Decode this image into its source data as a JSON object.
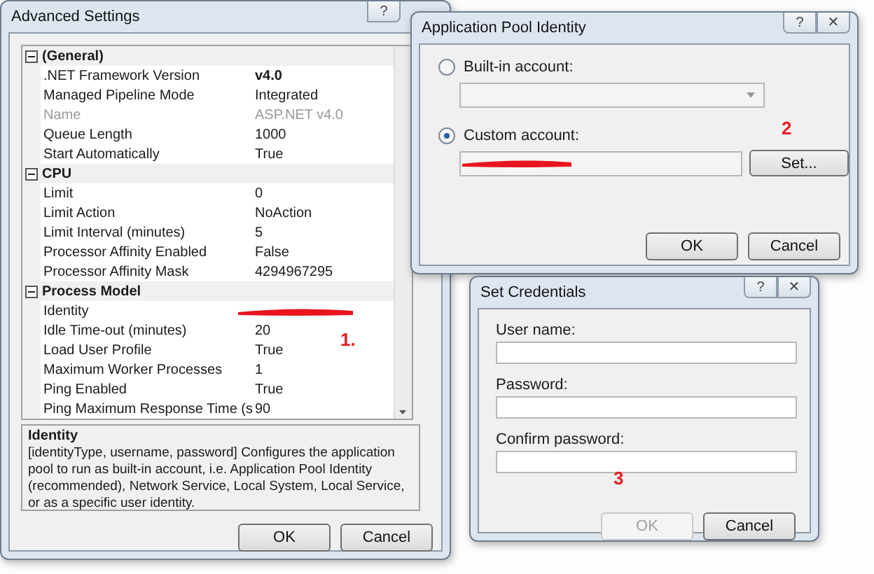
{
  "advanced_settings": {
    "title": "Advanced Settings",
    "help_button": "?",
    "categories": [
      {
        "name": "(General)",
        "expanded": true,
        "properties": [
          {
            "name": ".NET Framework Version",
            "value": "v4.0",
            "bold": true,
            "disabled": false
          },
          {
            "name": "Managed Pipeline Mode",
            "value": "Integrated",
            "bold": false,
            "disabled": false,
            "redacted": false
          },
          {
            "name": "Name",
            "value": "ASP.NET v4.0",
            "bold": false,
            "disabled": true,
            "redacted": false
          },
          {
            "name": "Queue Length",
            "value": "1000",
            "bold": false,
            "disabled": false,
            "redacted": false
          },
          {
            "name": "Start Automatically",
            "value": "True",
            "bold": false,
            "disabled": false,
            "redacted": false
          }
        ]
      },
      {
        "name": "CPU",
        "expanded": true,
        "properties": [
          {
            "name": "Limit",
            "value": "0",
            "bold": false,
            "disabled": false,
            "redacted": false
          },
          {
            "name": "Limit Action",
            "value": "NoAction",
            "bold": false,
            "disabled": false,
            "redacted": false
          },
          {
            "name": "Limit Interval (minutes)",
            "value": "5",
            "bold": false,
            "disabled": false,
            "redacted": false
          },
          {
            "name": "Processor Affinity Enabled",
            "value": "False",
            "bold": false,
            "disabled": false,
            "redacted": false
          },
          {
            "name": "Processor Affinity Mask",
            "value": "4294967295",
            "bold": false,
            "disabled": false,
            "redacted": false
          }
        ]
      },
      {
        "name": "Process Model",
        "expanded": true,
        "properties": [
          {
            "name": "Identity",
            "disabled": false,
            "redacted": true,
            "annotation": "1."
          },
          {
            "name": "Idle Time-out (minutes)",
            "value": "20",
            "bold": false,
            "disabled": false,
            "redacted": false
          },
          {
            "name": "Load User Profile",
            "value": "True",
            "bold": false,
            "disabled": false,
            "redacted": false
          },
          {
            "name": "Maximum Worker Processes",
            "value": "1",
            "bold": false,
            "disabled": false,
            "redacted": false
          },
          {
            "name": "Ping Enabled",
            "value": "True",
            "bold": false,
            "disabled": false,
            "redacted": false
          },
          {
            "name": "Ping Maximum Response Time (s",
            "value": "90",
            "bold": false,
            "disabled": false,
            "redacted": false
          }
        ]
      }
    ],
    "description": {
      "title": "Identity",
      "text": "[identityType, username, password] Configures the application pool to run as built-in account, i.e. Application Pool Identity (recommended), Network Service, Local System, Local Service, or as a specific user identity."
    },
    "buttons": [
      {
        "label": "OK",
        "disabled": false
      },
      {
        "label": "Cancel",
        "disabled": false
      }
    ]
  },
  "app_pool_identity": {
    "title": "Application Pool Identity",
    "help_button": "?",
    "close_button": "✕",
    "options": [
      {
        "label": "Built-in account:",
        "selected": false,
        "kind": "dropdown"
      },
      {
        "label": "Custom account:",
        "selected": true,
        "kind": "field",
        "redacted": true
      }
    ],
    "set_button": "Set...",
    "annotation": "2",
    "buttons": [
      {
        "label": "OK",
        "disabled": false
      },
      {
        "label": "Cancel",
        "disabled": false
      }
    ]
  },
  "set_credentials": {
    "title": "Set Credentials",
    "help_button": "?",
    "close_button": "✕",
    "fields": [
      {
        "label": "User name:"
      },
      {
        "label": "Password:"
      },
      {
        "label": "Confirm password:"
      }
    ],
    "annotation": "3",
    "buttons": [
      {
        "label": "OK",
        "disabled": true
      },
      {
        "label": "Cancel",
        "disabled": false
      }
    ]
  }
}
